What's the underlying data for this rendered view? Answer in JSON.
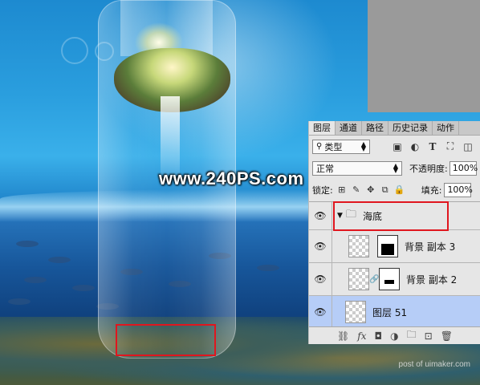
{
  "watermark": "www.240PS.com",
  "credit": "post of uimaker.com",
  "panel": {
    "tabs": [
      "图层",
      "通道",
      "路径",
      "历史记录",
      "动作"
    ],
    "filter": {
      "label": "类型"
    },
    "filter_icons": [
      "image-icon",
      "adjust-icon",
      "type-icon",
      "shape-icon",
      "smart-object-icon"
    ],
    "blend_mode": "正常",
    "opacity_label": "不透明度:",
    "opacity_value": "100%",
    "lock_label": "锁定:",
    "fill_label": "填充:",
    "fill_value": "100%",
    "layers": [
      {
        "name": "海底",
        "type": "group"
      },
      {
        "name": "背景 副本 3"
      },
      {
        "name": "背景 副本 2"
      },
      {
        "name": "图层 51",
        "selected": true
      }
    ],
    "footer_icons": [
      "link-icon",
      "fx-icon",
      "mask-icon",
      "adjustment-icon",
      "folder-icon",
      "new-layer-icon",
      "trash-icon"
    ]
  }
}
